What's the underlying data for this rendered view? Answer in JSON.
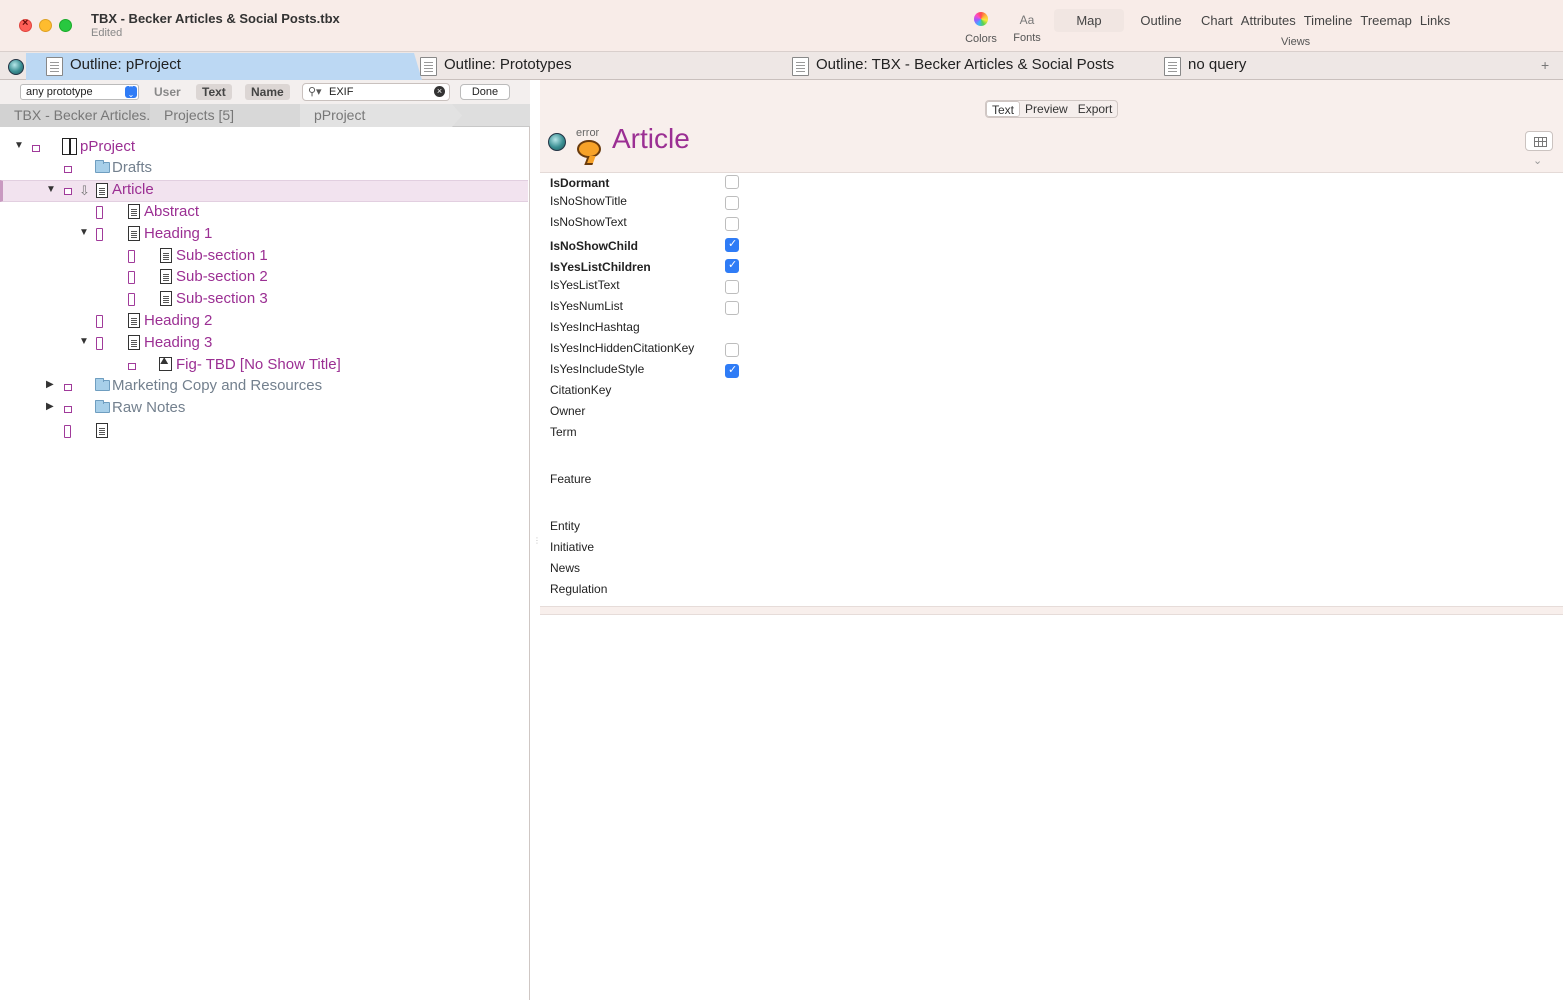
{
  "window": {
    "title": "TBX - Becker Articles & Social Posts.tbx",
    "subtitle": "Edited"
  },
  "toolbar": {
    "colors_label": "Colors",
    "fonts_glyph": "Aa",
    "fonts_label": "Fonts",
    "views_label": "Views",
    "views": [
      "Map",
      "Outline",
      "Chart",
      "Attributes",
      "Timeline",
      "Treemap",
      "Links"
    ]
  },
  "tabs": [
    {
      "label": "Outline: pProject",
      "active": true
    },
    {
      "label": "Outline: Prototypes",
      "active": false
    },
    {
      "label": "Outline: TBX - Becker Articles & Social Posts",
      "active": false
    },
    {
      "label": "no query",
      "active": false
    }
  ],
  "tab_add": "+",
  "filter": {
    "prototype_value": "any prototype",
    "seg_user": "User",
    "seg_text": "Text",
    "seg_name": "Name",
    "search_value": "EXIF",
    "done_label": "Done"
  },
  "breadcrumb": [
    "TBX - Becker Articles...",
    "Projects [5]",
    "pProject"
  ],
  "outline": [
    {
      "label": "pProject",
      "level": 0,
      "expanded": true,
      "icon": "prototype",
      "badge": "small",
      "color": "purple"
    },
    {
      "label": "Drafts",
      "level": 1,
      "icon": "folder",
      "badge": "small",
      "color": "grey"
    },
    {
      "label": "Article",
      "level": 1,
      "expanded": true,
      "icon": "doc",
      "badge": "small",
      "alias": true,
      "color": "purple",
      "selected": true
    },
    {
      "label": "Abstract",
      "level": 2,
      "icon": "doc",
      "badge": "tall",
      "color": "purple"
    },
    {
      "label": "Heading 1",
      "level": 2,
      "expanded": true,
      "icon": "doc",
      "badge": "tall",
      "color": "purple"
    },
    {
      "label": "Sub-section 1",
      "level": 3,
      "icon": "doc",
      "badge": "tall",
      "color": "purple"
    },
    {
      "label": "Sub-section 2",
      "level": 3,
      "icon": "doc",
      "badge": "tall",
      "color": "purple"
    },
    {
      "label": "Sub-section 3",
      "level": 3,
      "icon": "doc",
      "badge": "tall",
      "color": "purple"
    },
    {
      "label": "Heading 2",
      "level": 2,
      "icon": "doc",
      "badge": "tall",
      "color": "purple"
    },
    {
      "label": "Heading 3",
      "level": 2,
      "expanded": true,
      "icon": "doc",
      "badge": "tall",
      "color": "purple"
    },
    {
      "label": "Fig- TBD [No Show Title]",
      "level": 3,
      "icon": "image",
      "badge": "small",
      "color": "purple"
    },
    {
      "label": "Marketing Copy and Resources",
      "level": 1,
      "collapsed": true,
      "icon": "folder",
      "badge": "small",
      "color": "grey"
    },
    {
      "label": "Raw Notes",
      "level": 1,
      "collapsed": true,
      "icon": "folder",
      "badge": "small",
      "color": "grey"
    },
    {
      "label": "",
      "level": 1,
      "icon": "doc",
      "badge": "tall",
      "color": "purple"
    }
  ],
  "editor": {
    "mode_tabs": [
      "Text",
      "Preview",
      "Export"
    ],
    "active_mode": "Text",
    "badge_label": "error",
    "note_title": "Article",
    "collapse_glyph": "⌄"
  },
  "attributes": [
    {
      "name": "IsDormant",
      "bold": true,
      "checkbox": true,
      "checked": false
    },
    {
      "name": "IsNoShowTitle",
      "bold": false,
      "checkbox": true,
      "checked": false
    },
    {
      "name": "IsNoShowText",
      "bold": false,
      "checkbox": true,
      "checked": false
    },
    {
      "name": "IsNoShowChild",
      "bold": true,
      "checkbox": true,
      "checked": true
    },
    {
      "name": "IsYesListChildren",
      "bold": true,
      "checkbox": true,
      "checked": true
    },
    {
      "name": "IsYesListText",
      "bold": false,
      "checkbox": true,
      "checked": false
    },
    {
      "name": "IsYesNumList",
      "bold": false,
      "checkbox": true,
      "checked": false
    },
    {
      "name": "IsYesIncHashtag",
      "bold": false,
      "checkbox": false,
      "checked": false
    },
    {
      "name": "IsYesIncHiddenCitationKey",
      "bold": false,
      "checkbox": true,
      "checked": false
    },
    {
      "name": "IsYesIncludeStyle",
      "bold": false,
      "checkbox": true,
      "checked": true
    },
    {
      "name": "CitationKey",
      "bold": false,
      "checkbox": false
    },
    {
      "name": "Owner",
      "bold": false,
      "checkbox": false
    },
    {
      "name": "Term",
      "bold": false,
      "checkbox": false
    },
    {
      "name": "Feature",
      "bold": false,
      "checkbox": false
    },
    {
      "name": "Entity",
      "bold": false,
      "checkbox": false
    },
    {
      "name": "Initiative",
      "bold": false,
      "checkbox": false
    },
    {
      "name": "News",
      "bold": false,
      "checkbox": false
    },
    {
      "name": "Regulation",
      "bold": false,
      "checkbox": false
    }
  ],
  "colors": {
    "accent_purple": "#9b2f93",
    "tab_active": "#bcd8f3",
    "checkbox_blue": "#2f7cf6"
  }
}
